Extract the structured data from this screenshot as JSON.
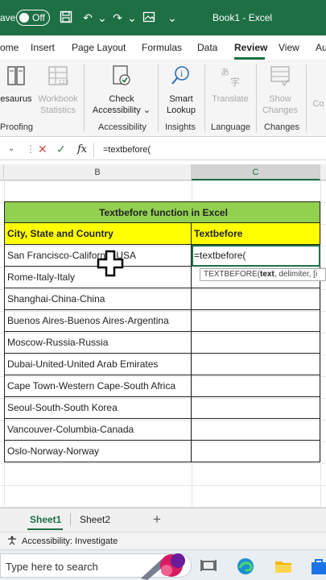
{
  "titlebar": {
    "autosave_label": "ave",
    "toggle_state": "Off",
    "book_title": "Book1 - Excel"
  },
  "tabs": [
    "ome",
    "Insert",
    "Page Layout",
    "Formulas",
    "Data",
    "Review",
    "View",
    "Au"
  ],
  "active_tab": "Review",
  "ribbon": {
    "thesaurus": "esaurus",
    "workbook_stats": [
      "Workbook",
      "Statistics"
    ],
    "check_accessibility": [
      "Check",
      "Accessibility"
    ],
    "smart_lookup": [
      "Smart",
      "Lookup"
    ],
    "translate": "Translate",
    "show_changes": [
      "Show",
      "Changes"
    ],
    "comments_partial": [
      "Co"
    ],
    "groups": {
      "proofing": "Proofing",
      "accessibility": "Accessibility",
      "insights": "Insights",
      "language": "Language",
      "changes": "Changes"
    }
  },
  "formula_bar": {
    "fx_label": "fx",
    "formula": "=textbefore("
  },
  "columns": {
    "b": "B",
    "c": "C"
  },
  "sheet": {
    "title": "Textbefore  function in Excel",
    "header_left": "City, State and Country",
    "header_right": "Textbefore",
    "rows": [
      "San Francisco-California-USA",
      "Rome-Italy-Italy",
      "Shanghai-China-China",
      "Buenos Aires-Buenos Aires-Argentina",
      "Moscow-Russia-Russia",
      "Dubai-United-United Arab Emirates",
      "Cape Town-Western Cape-South Africa",
      "Seoul-South-South Korea",
      "Vancouver-Columbia-Canada",
      "Oslo-Norway-Norway"
    ],
    "active_cell_value": "=textbefore("
  },
  "tooltip": {
    "func": "TEXTBEFORE(",
    "arg1": "text",
    "rest": ", delimiter, [i"
  },
  "sheet_tabs": {
    "sheet1": "Sheet1",
    "sheet2": "Sheet2",
    "add": "+"
  },
  "status": {
    "accessibility": "Accessibility: Investigate"
  },
  "taskbar": {
    "search_placeholder": "Type here to search"
  },
  "colors": {
    "excel_green": "#1e6f44",
    "title_fill": "#92d050",
    "header_fill": "#ffff00"
  }
}
